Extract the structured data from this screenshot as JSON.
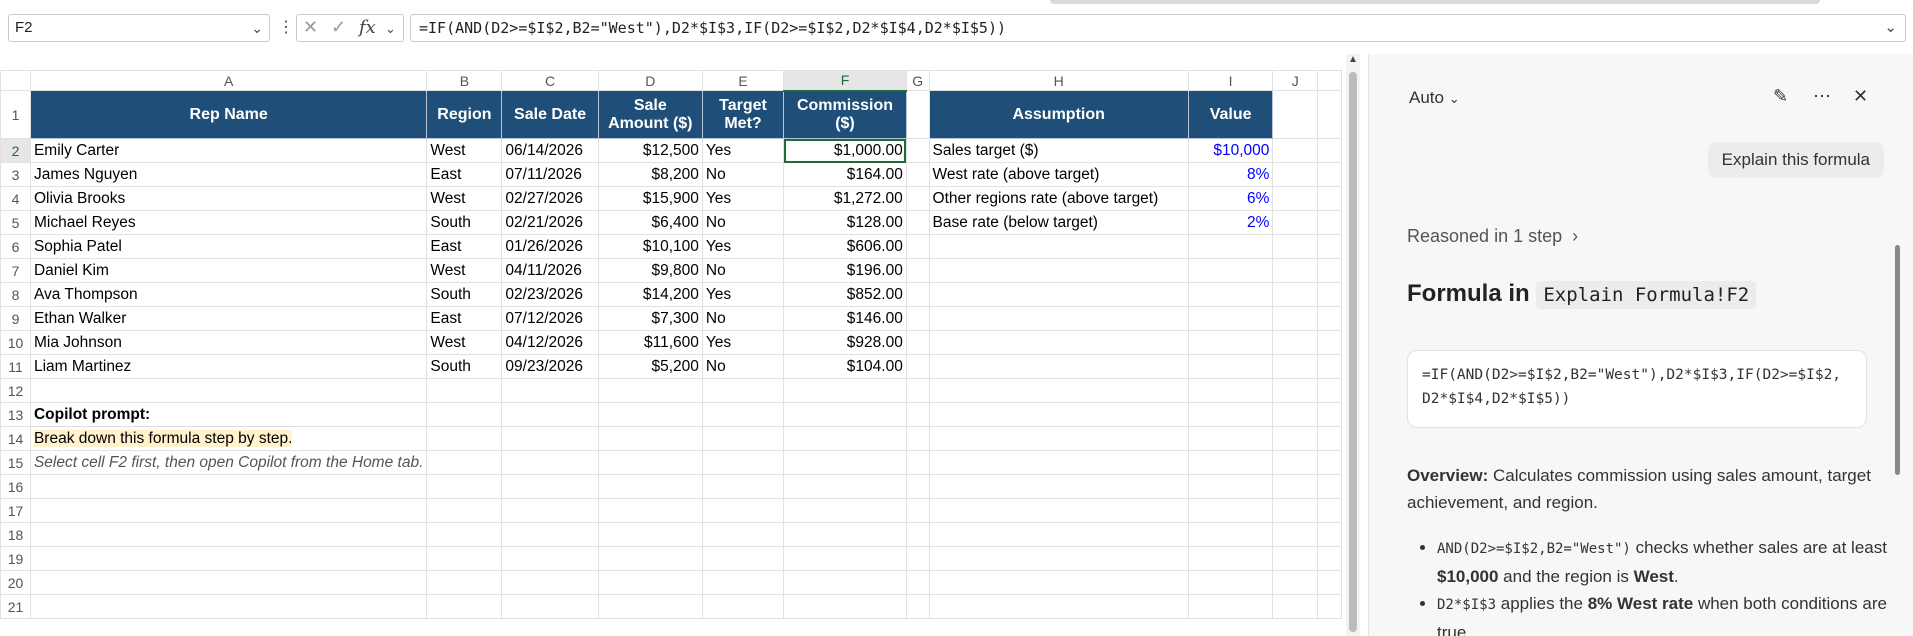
{
  "formula_bar": {
    "cell_ref": "F2",
    "formula": "=IF(AND(D2>=$I$2,B2=\"West\"),D2*$I$3,IF(D2>=$I$2,D2*$I$4,D2*$I$5))"
  },
  "columns": [
    "A",
    "B",
    "C",
    "D",
    "E",
    "F",
    "G",
    "H",
    "I",
    "J"
  ],
  "rows": [
    "1",
    "2",
    "3",
    "4",
    "5",
    "6",
    "7",
    "8",
    "9",
    "10",
    "11",
    "12",
    "13",
    "14",
    "15",
    "16",
    "17",
    "18",
    "19",
    "20",
    "21"
  ],
  "headers": {
    "rep": "Rep Name",
    "region": "Region",
    "date": "Sale Date",
    "amount": "Sale Amount ($)",
    "target": "Target Met?",
    "commission": "Commission ($)",
    "assumption": "Assumption",
    "value": "Value"
  },
  "table": [
    {
      "rep": "Emily Carter",
      "region": "West",
      "date": "06/14/2026",
      "amount": "$12,500",
      "met": "Yes",
      "comm": "$1,000.00"
    },
    {
      "rep": "James Nguyen",
      "region": "East",
      "date": "07/11/2026",
      "amount": "$8,200",
      "met": "No",
      "comm": "$164.00"
    },
    {
      "rep": "Olivia Brooks",
      "region": "West",
      "date": "02/27/2026",
      "amount": "$15,900",
      "met": "Yes",
      "comm": "$1,272.00"
    },
    {
      "rep": "Michael Reyes",
      "region": "South",
      "date": "02/21/2026",
      "amount": "$6,400",
      "met": "No",
      "comm": "$128.00"
    },
    {
      "rep": "Sophia Patel",
      "region": "East",
      "date": "01/26/2026",
      "amount": "$10,100",
      "met": "Yes",
      "comm": "$606.00"
    },
    {
      "rep": "Daniel Kim",
      "region": "West",
      "date": "04/11/2026",
      "amount": "$9,800",
      "met": "No",
      "comm": "$196.00"
    },
    {
      "rep": "Ava Thompson",
      "region": "South",
      "date": "02/23/2026",
      "amount": "$14,200",
      "met": "Yes",
      "comm": "$852.00"
    },
    {
      "rep": "Ethan Walker",
      "region": "East",
      "date": "07/12/2026",
      "amount": "$7,300",
      "met": "No",
      "comm": "$146.00"
    },
    {
      "rep": "Mia Johnson",
      "region": "West",
      "date": "04/12/2026",
      "amount": "$11,600",
      "met": "Yes",
      "comm": "$928.00"
    },
    {
      "rep": "Liam Martinez",
      "region": "South",
      "date": "09/23/2026",
      "amount": "$5,200",
      "met": "No",
      "comm": "$104.00"
    }
  ],
  "assumptions": [
    {
      "label": "Sales target ($)",
      "value": "$10,000"
    },
    {
      "label": "West rate (above target)",
      "value": "8%"
    },
    {
      "label": "Other regions rate (above target)",
      "value": "6%"
    },
    {
      "label": "Base rate (below target)",
      "value": "2%"
    }
  ],
  "notes": {
    "prompt_label": "Copilot prompt:",
    "prompt_text": "Break down this formula step by step.",
    "instruction": "Select cell F2 first, then open Copilot from the Home tab."
  },
  "copilot": {
    "mode": "Auto",
    "user_message": "Explain this formula",
    "reasoned": "Reasoned in 1 step",
    "title_prefix": "Formula in",
    "title_ref": "Explain Formula!F2",
    "code_line1": "=IF(AND(D2>=$I$2,B2=\"West\"),D2*$I$3,IF(D2>=$I$2,",
    "code_line2": "D2*$I$4,D2*$I$5))",
    "overview_label": "Overview:",
    "overview_text": " Calculates commission using sales amount, target achievement, and region.",
    "b1_code": "AND(D2>=$I$2,B2=\"West\")",
    "b1_text1": " checks whether sales are at least ",
    "b1_bold1": "$10,000",
    "b1_text2": " and the region is ",
    "b1_bold2": "West",
    "b1_text3": ".",
    "b2_code": "D2*$I$3",
    "b2_text1": " applies the ",
    "b2_bold1": "8% West rate",
    "b2_text2": " when both conditions are true."
  },
  "colors": {
    "header_fill": "#1f4e79",
    "selection": "#1d6b3a",
    "input_blue": "#0000ff",
    "highlight": "#fff2cc"
  }
}
